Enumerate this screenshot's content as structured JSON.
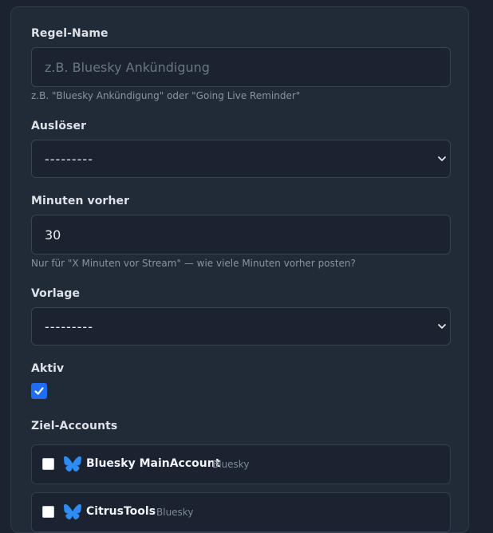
{
  "form": {
    "rule_name": {
      "label": "Regel-Name",
      "placeholder": "z.B. Bluesky Ankündigung",
      "value": "",
      "help": "z.B. \"Bluesky Ankündigung\" oder \"Going Live Reminder\""
    },
    "trigger": {
      "label": "Auslöser",
      "selected": "---------"
    },
    "minutes_before": {
      "label": "Minuten vorher",
      "value": "30",
      "help": "Nur für \"X Minuten vor Stream\" — wie viele Minuten vorher posten?"
    },
    "template": {
      "label": "Vorlage",
      "selected": "---------"
    },
    "active": {
      "label": "Aktiv",
      "checked": true
    },
    "target_accounts": {
      "label": "Ziel-Accounts",
      "items": [
        {
          "name": "Bluesky MainAccount",
          "platform": "Bluesky",
          "checked": false,
          "icon": "butterfly-icon"
        },
        {
          "name": "CitrusTools",
          "platform": "Bluesky",
          "checked": false,
          "icon": "butterfly-icon"
        }
      ]
    }
  },
  "colors": {
    "page_bg": "#1c2330",
    "card_bg": "#212a37",
    "input_bg": "#1b2230",
    "accent": "#1f6df2",
    "bluesky": "#2f8cf5"
  }
}
